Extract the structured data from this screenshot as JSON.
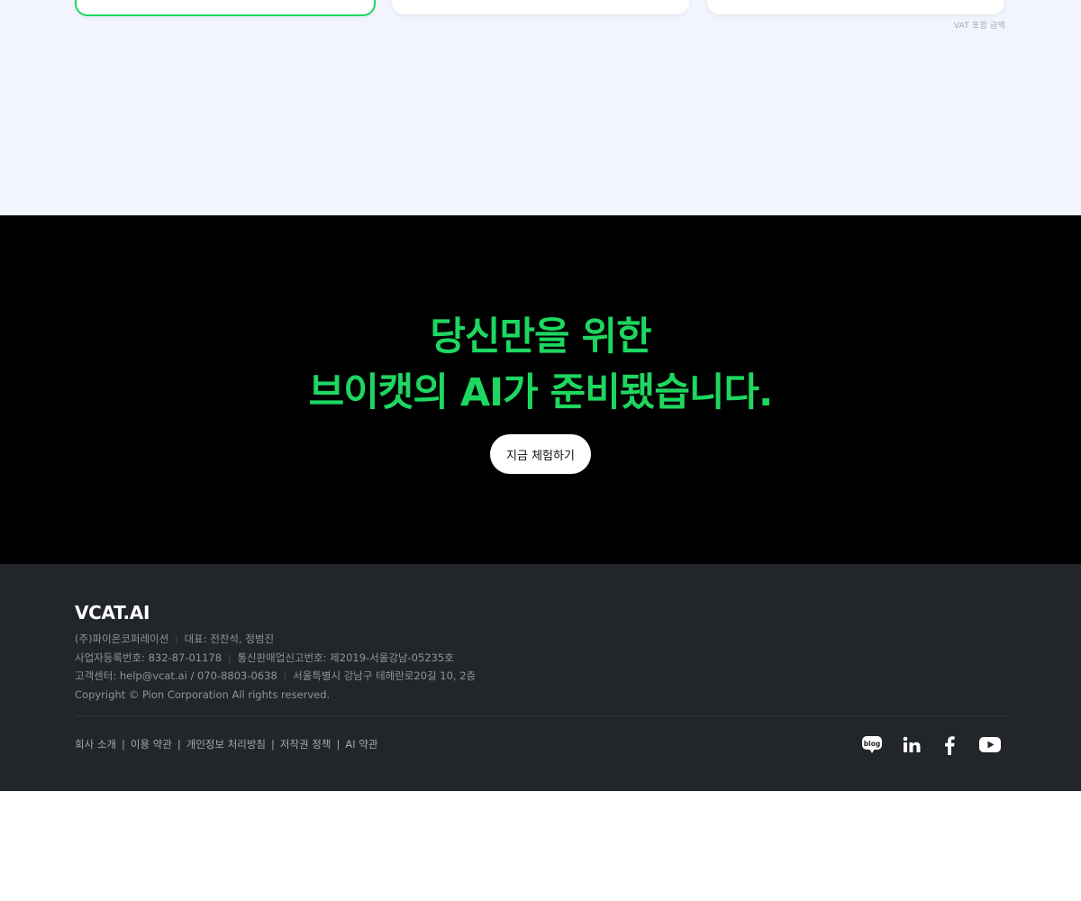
{
  "pricing": {
    "vat_note": "VAT 포함 금액"
  },
  "cta": {
    "title_line1": "당신만을 위한",
    "title_line2": "브이캣의 AI가 준비됐습니다.",
    "button_label": "지금 체험하기",
    "accent_color": "#1ed760"
  },
  "footer": {
    "logo": "VCAT.AI",
    "company_name": "(주)파이온코퍼레이션",
    "ceo": "대표: 전찬석, 정범진",
    "business_reg": "사업자등록번호: 832-87-01178",
    "mail_order_reg": "통신판매업신고번호: 제2019-서울강남-05235호",
    "customer_center": "고객센터: help@vcat.ai / 070-8803-0638",
    "address": "서울특별시 강남구 테헤란로20길 10, 2층",
    "copyright": "Copyright © Pion Corporation All rights reserved.",
    "links": [
      "회사 소개",
      "이용 약관",
      "개인정보 처리방침",
      "저작권 정책",
      "AI 약관"
    ],
    "social": [
      {
        "icon": "blog-icon",
        "label": "blog"
      },
      {
        "icon": "linkedin-icon"
      },
      {
        "icon": "facebook-icon"
      },
      {
        "icon": "youtube-icon"
      }
    ]
  }
}
